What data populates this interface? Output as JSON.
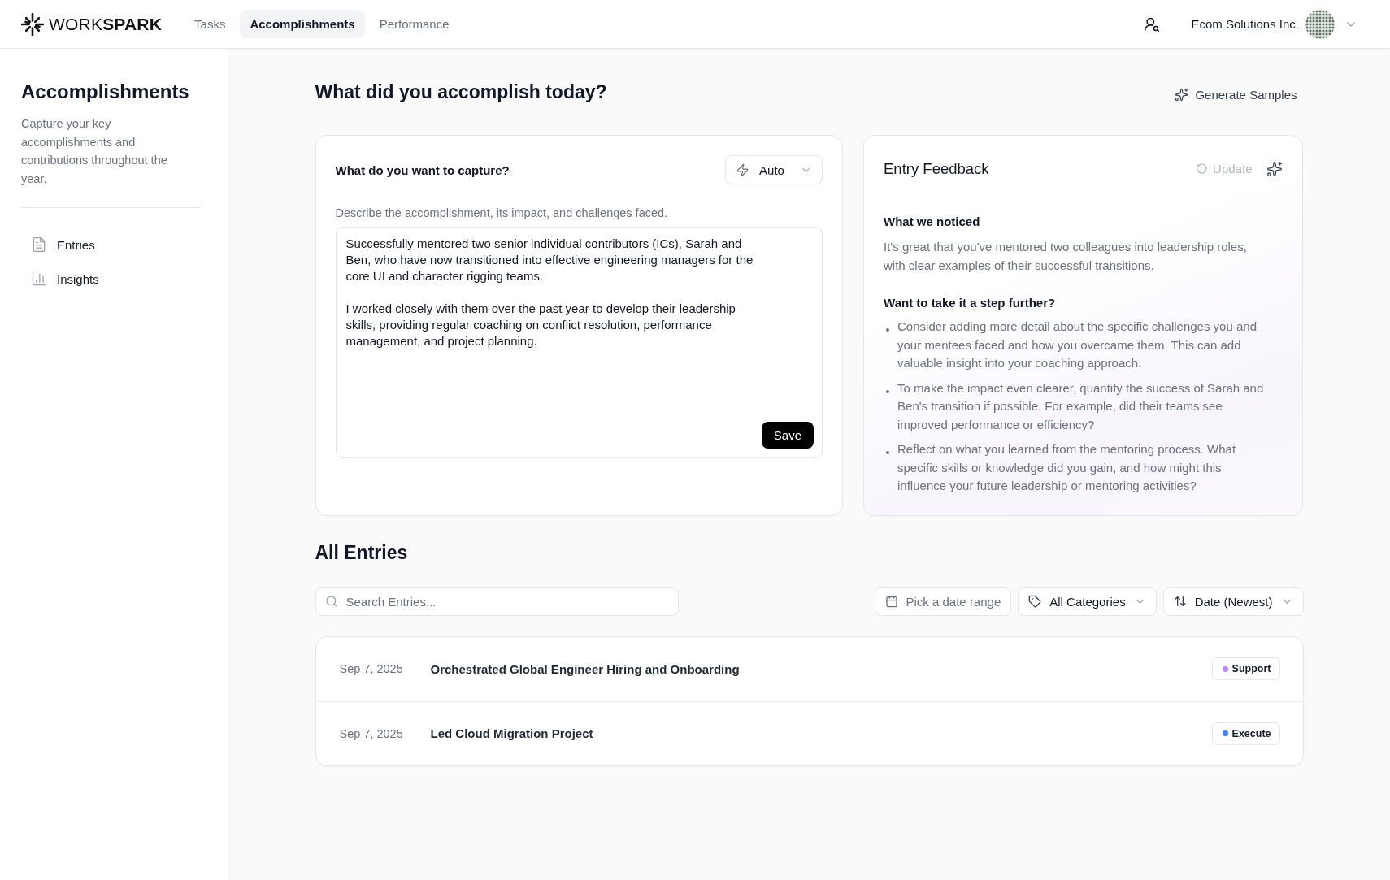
{
  "header": {
    "logo": "WORK**SPARK**",
    "nav": [
      {
        "label": "Tasks",
        "selected": false
      },
      {
        "label": "Accomplishments",
        "selected": true
      },
      {
        "label": "Performance",
        "selected": false
      }
    ],
    "organization": "Ecom Solutions Inc."
  },
  "sidebar": {
    "title": "Accomplishments",
    "description": "Capture your key accomplishments and contributions throughout the year.",
    "items": [
      {
        "label": "Entries"
      },
      {
        "label": "Insights"
      }
    ]
  },
  "main": {
    "title": "What did you accomplish today?",
    "generate_button": "Generate Samples"
  },
  "capture": {
    "title": "What do you want to capture?",
    "mode": "Auto",
    "description": "Describe the accomplishment, its impact, and challenges faced.",
    "value": "Successfully mentored two senior individual contributors (ICs), Sarah and Ben, who have now transitioned into effective engineering managers for the core UI and character rigging teams.\n\nI worked closely with them over the past year to develop their leadership skills, providing regular coaching on conflict resolution, performance management, and project planning.",
    "save_button": "Save"
  },
  "feedback": {
    "title": "Entry Feedback",
    "update_button": {
      "label": "Update",
      "disabled": true
    },
    "noticed_title": "What we noticed",
    "noticed_text": "It's great that you've mentored two colleagues into leadership roles, with clear examples of their successful transitions.",
    "further_title": "Want to take it a step further?",
    "suggestions": [
      "Consider adding more detail about the specific challenges you and your mentees faced and how you overcame them. This can add valuable insight into your coaching approach.",
      "To make the impact even clearer, quantify the success of Sarah and Ben's transition if possible. For example, did their teams see improved performance or efficiency?",
      "Reflect on what you learned from the mentoring process. What specific skills or knowledge did you gain, and how might this influence your future leadership or mentoring activities?"
    ]
  },
  "entries": {
    "title": "All Entries",
    "search": {
      "placeholder": "Search Entries..."
    },
    "date_filter": {
      "placeholder": "Pick a date range"
    },
    "category_filter": "All Categories",
    "sort": "Date (Newest)",
    "rows": [
      {
        "date": "Sep 7, 2025",
        "title": "Orchestrated Global Engineer Hiring and Onboarding",
        "category": "Support",
        "color": "#c084fc"
      },
      {
        "date": "Sep 7, 2025",
        "title": "Led Cloud Migration Project",
        "category": "Execute",
        "color": "#3b82f6"
      }
    ]
  }
}
